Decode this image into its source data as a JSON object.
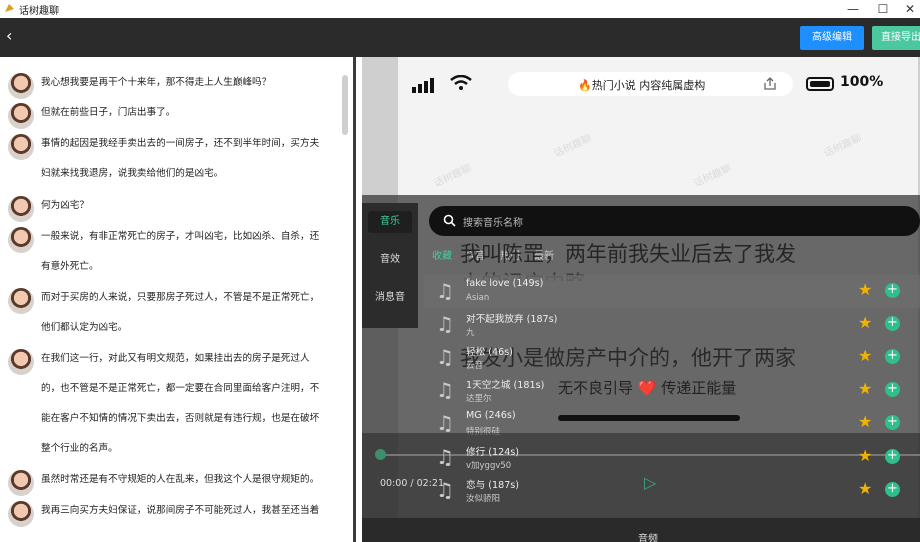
{
  "window": {
    "title": "话树趣聊",
    "controls": [
      "—",
      "☐",
      "✕"
    ]
  },
  "header": {
    "back_icon": "‹",
    "advanced_edit": "高级编辑",
    "direct_export": "直接导出"
  },
  "messages": [
    "我心想我要是再干个十来年，那不得走上人生巅峰吗？",
    "但就在前些日子，门店出事了。",
    "事情的起因是我经手卖出去的一间房子，还不到半年时间，买方夫",
    "妇就来找我退房，说我卖给他们的是凶宅。",
    "何为凶宅？",
    "一般来说，有非正常死亡的房子，才叫凶宅，比如凶杀、自杀，还",
    "有意外死亡。",
    "而对于买房的人来说，只要那房子死过人，不管是不是正常死亡，",
    "他们都认定为凶宅。",
    "在我们这一行，对此又有明文规范，如果挂出去的房子是死过人",
    "的，也不管是不是正常死亡，都一定要在合同里面给客户注明，不",
    "能在客户不知情的情况下卖出去，否则就是有违行规，也是在破坏",
    "整个行业的名声。",
    "虽然时常还是有不守规矩的人在乱来，但我这个人是很守规矩的。",
    "我再三向买方夫妇保证，说那间房子不可能死过人，我甚至还当着"
  ],
  "phone": {
    "status_title": "🔥热门小说 内容纯属虚构",
    "battery": "100%",
    "watermark": "话树趣聊",
    "line1": "我叫陈罡，两年前我失业后去了我发",
    "line2": "小的记广中略",
    "line3": "我发小是做房产中介的，他开了两家",
    "slogan": "无不良引导 ❤️ 传递正能量"
  },
  "music": {
    "categories": [
      "音乐",
      "音效",
      "消息音"
    ],
    "search_placeholder": "搜索音乐名称",
    "tabs": [
      "收藏",
      "抖音",
      "热门",
      "最新"
    ],
    "songs": [
      {
        "name": "fake love (149s)",
        "artist": "Asian"
      },
      {
        "name": "对不起我放弃 (187s)",
        "artist": "九"
      },
      {
        "name": "轻松 (46s)",
        "artist": "云音"
      },
      {
        "name": "1天空之城 (181s)",
        "artist": "达里尔"
      },
      {
        "name": "MG (246s)",
        "artist": "特别很硅"
      },
      {
        "name": "修行 (124s)",
        "artist": "v加yggv50"
      },
      {
        "name": "恋与 (187s)",
        "artist": "汝似骄阳"
      }
    ],
    "time": "00:00 / 02:21",
    "bottom_label": "音频"
  },
  "colors": {
    "accent": "#2ec08a",
    "star": "#f0b400",
    "edit_button": "#1e8fff",
    "export_button": "#4bc8a0"
  }
}
